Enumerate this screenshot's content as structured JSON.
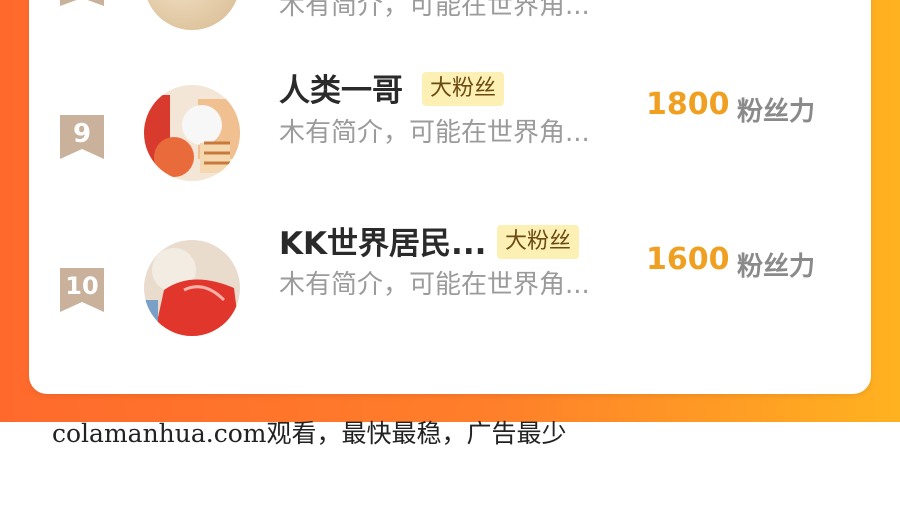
{
  "colors": {
    "accent": "#f0a020",
    "badge_bg": "#fdf0b4",
    "gradient_start": "#ff6a2c",
    "gradient_end": "#ffb220",
    "rank_ribbon": "#c9b19b"
  },
  "partial_row": {
    "desc": "木有简介，可能在世界角..."
  },
  "rows": [
    {
      "rank": "9",
      "name": "人类一哥",
      "badge": "大粉丝",
      "desc": "木有简介，可能在世界角...",
      "score": "1800",
      "score_unit": "粉丝力"
    },
    {
      "rank": "10",
      "name": "KK世界居民...",
      "badge": "大粉丝",
      "desc": "木有简介，可能在世界角...",
      "score": "1600",
      "score_unit": "粉丝力"
    }
  ],
  "footer_text": "colamanhua.com观看，最快最稳，广告最少"
}
